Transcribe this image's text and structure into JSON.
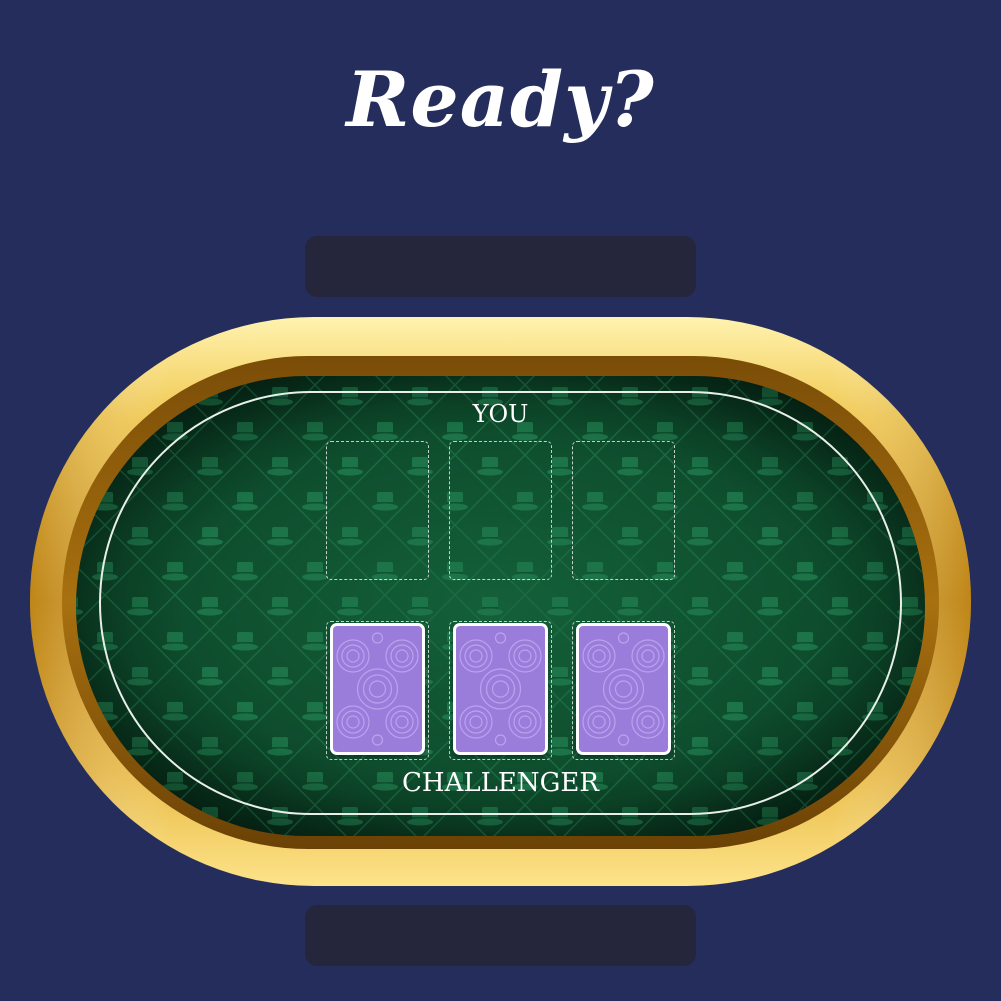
{
  "screen": {
    "title": "Ready?",
    "background_color": "#252d5d"
  },
  "table": {
    "felt_color": "#0f4a2c",
    "rim_color": "#e0b23a",
    "pattern_icon": "top-hat-icon",
    "player_label": "YOU",
    "opponent_label": "CHALLENGER"
  },
  "player_slots": [
    {
      "state": "empty"
    },
    {
      "state": "empty"
    },
    {
      "state": "empty"
    }
  ],
  "opponent_cards": [
    {
      "state": "face-down",
      "back_color": "#9a7ddb"
    },
    {
      "state": "face-down",
      "back_color": "#9a7ddb"
    },
    {
      "state": "face-down",
      "back_color": "#9a7ddb"
    }
  ]
}
